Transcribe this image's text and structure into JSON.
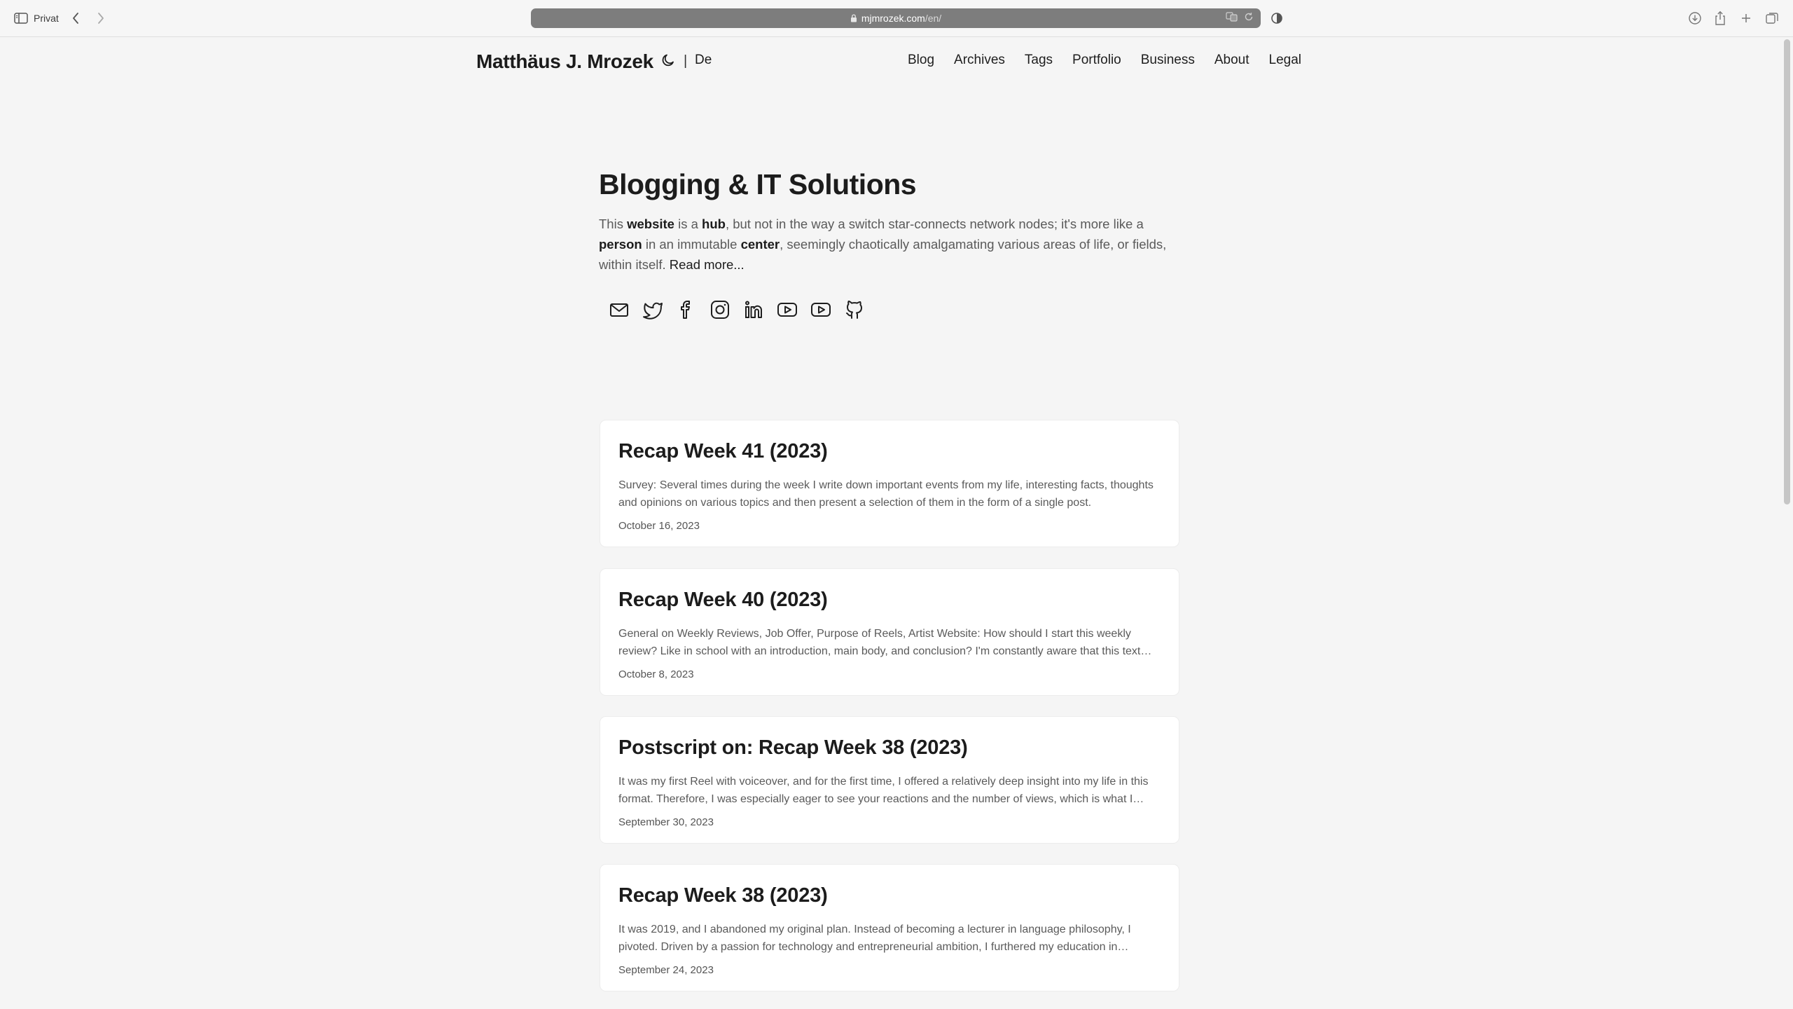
{
  "browser": {
    "private_label": "Privat",
    "url_host": "mjmrozek.com",
    "url_path": "/en/"
  },
  "site": {
    "title": "Matthäus J. Mrozek",
    "separator": "|",
    "language": "De",
    "nav": [
      "Blog",
      "Archives",
      "Tags",
      "Portfolio",
      "Business",
      "About",
      "Legal"
    ]
  },
  "hero": {
    "heading": "Blogging & IT Solutions",
    "intro_parts": {
      "t1": "This ",
      "b1": "website",
      "t2": " is a ",
      "b2": "hub",
      "t3": ", but not in the way a switch star-connects network nodes; it's more like a ",
      "b3": "person",
      "t4": " in an immutable ",
      "b4": "center",
      "t5": ", seemingly chaotically amalgamating various areas of life, or fields, within itself. ",
      "read_more": "Read more..."
    },
    "social_icons": [
      "mail-icon",
      "twitter-icon",
      "facebook-icon",
      "instagram-icon",
      "linkedin-icon",
      "youtube-icon",
      "youtube-icon",
      "github-icon"
    ]
  },
  "posts": [
    {
      "title": "Recap Week 41 (2023)",
      "excerpt": "Survey: Several times during the week I write down important events from my life, interesting facts, thoughts and opinions on various topics and then present a selection of them in the form of a single post.",
      "date": "October 16, 2023"
    },
    {
      "title": "Recap Week 40 (2023)",
      "excerpt": "General on Weekly Reviews, Job Offer, Purpose of Reels, Artist Website: How should I start this weekly review? Like in school with an introduction, main body, and conclusion? I'm constantly aware that this text will be read.",
      "date": "October 8, 2023"
    },
    {
      "title": "Postscript on: Recap Week 38 (2023)",
      "excerpt": "It was my first Reel with voiceover, and for the first time, I offered a relatively deep insight into my life in this format. Therefore, I was especially eager to see your reactions and the number of views, which is what I want to talk about.",
      "date": "September 30, 2023"
    },
    {
      "title": "Recap Week 38 (2023)",
      "excerpt": "It was 2019, and I abandoned my original plan. Instead of becoming a lecturer in language philosophy, I pivoted. Driven by a passion for technology and entrepreneurial ambition, I furthered my education in software development.",
      "date": "September 24, 2023"
    }
  ]
}
